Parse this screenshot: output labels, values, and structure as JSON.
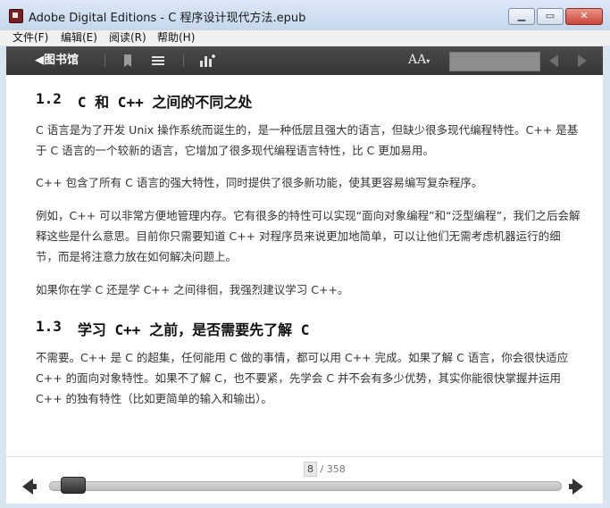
{
  "window": {
    "title": "Adobe Digital Editions - C  程序设计现代方法.epub",
    "buttons": {
      "minimize": "▁",
      "maximize": "▭",
      "close": "✕"
    }
  },
  "menu": [
    "文件(F)",
    "编辑(E)",
    "阅读(R)",
    "帮助(H)"
  ],
  "toolbar": {
    "library_label": "◀图书馆",
    "font_label": "AA",
    "icons": [
      "bookmark-icon",
      "list-icon",
      "chart-icon",
      "font-size-icon",
      "search-input",
      "prev-arrow-icon",
      "next-arrow-icon"
    ]
  },
  "content": {
    "section1_num": "1.2",
    "section1_title": "C 和 C++ 之间的不同之处",
    "p1": "C 语言是为了开发 Unix 操作系统而诞生的，是一种低层且强大的语言，但缺少很多现代编程特性。C++ 是基于 C 语言的一个较新的语言，它增加了很多现代编程语言特性，比 C 更加易用。",
    "p2": "C++ 包含了所有 C 语言的强大特性，同时提供了很多新功能，使其更容易编写复杂程序。",
    "p3": "例如，C++ 可以非常方便地管理内存。它有很多的特性可以实现“面向对象编程”和“泛型编程”，我们之后会解释这些是什么意思。目前你只需要知道 C++ 对程序员来说更加地简单，可以让他们无需考虑机器运行的细节，而是将注意力放在如何解决问题上。",
    "p4": "如果你在学 C 还是学 C++ 之间徘徊，我强烈建议学习 C++。",
    "section2_num": "1.3",
    "section2_title": "学习 C++ 之前，是否需要先了解 C",
    "p5": "不需要。C++ 是 C 的超集，任何能用 C 做的事情，都可以用 C++ 完成。如果了解 C 语言，你会很快适应 C++ 的面向对象特性。如果不了解 C，也不要紧，先学会 C 并不会有多少优势，其实你能很快掌握并运用 C++ 的独有特性（比如更简单的输入和输出）。"
  },
  "pagination": {
    "current": "8",
    "total": "/ 358",
    "progress": 0.022
  },
  "colors": {
    "toolbar": "#3d3d3d",
    "window_frame": "#c6d7ec",
    "close_button": "#c9463a"
  }
}
